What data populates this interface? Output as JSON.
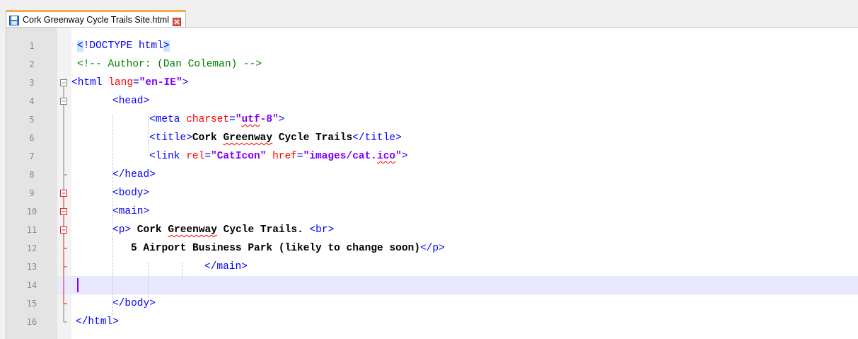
{
  "tab": {
    "title": "Cork Greenway Cycle Trails Site.html",
    "save_icon": "save-icon",
    "close_icon": "close-icon",
    "accent": "#f7a94b"
  },
  "editor": {
    "current_line": 14,
    "lines": [
      {
        "n": "1"
      },
      {
        "n": "2"
      },
      {
        "n": "3"
      },
      {
        "n": "4"
      },
      {
        "n": "5"
      },
      {
        "n": "6"
      },
      {
        "n": "7"
      },
      {
        "n": "8"
      },
      {
        "n": "9"
      },
      {
        "n": "10"
      },
      {
        "n": "11"
      },
      {
        "n": "12"
      },
      {
        "n": "13"
      },
      {
        "n": "14"
      },
      {
        "n": "15"
      },
      {
        "n": "16"
      }
    ],
    "code": {
      "l1": {
        "open": "<",
        "bang": "!DOCTYPE html",
        "close": ">"
      },
      "l2": {
        "comment": "<!-- Author: (Dan Coleman) -->"
      },
      "l3": {
        "tag": "<html ",
        "attr": "lang",
        "eq": "=",
        "val": "\"en-IE\"",
        "end": ">"
      },
      "l4": {
        "tag": "<head>"
      },
      "l5": {
        "tag": "<meta ",
        "attr": "charset",
        "eq": "=",
        "q1": "\"",
        "sq": "utf",
        "rest": "-8\"",
        "end": ">"
      },
      "l6": {
        "tag": "<title>",
        "t1": "Cork ",
        "sq": "Greenway",
        "t2": " Cycle Trails",
        "end": "</title>"
      },
      "l7": {
        "tag": "<link ",
        "a1": "rel",
        "eq1": "=",
        "v1": "\"CatIcon\"",
        "sp": " ",
        "a2": "href",
        "eq2": "=",
        "v2a": "\"images/cat.",
        "sq": "ico",
        "v2b": "\"",
        "end": ">"
      },
      "l8": {
        "tag": "</head>"
      },
      "l9": {
        "tag": "<body>"
      },
      "l10": {
        "tag": "<main>"
      },
      "l11": {
        "tag": "<p>",
        "t1": " Cork ",
        "sq": "Greenway",
        "t2": " Cycle Trails. ",
        "br": "<br>"
      },
      "l12": {
        "t": "5 Airport Business Park (likely to change soon)",
        "end": "</p>"
      },
      "l13": {
        "tag": "</main>"
      },
      "l15": {
        "tag": "</body>"
      },
      "l16": {
        "tag": "</html>"
      }
    }
  }
}
